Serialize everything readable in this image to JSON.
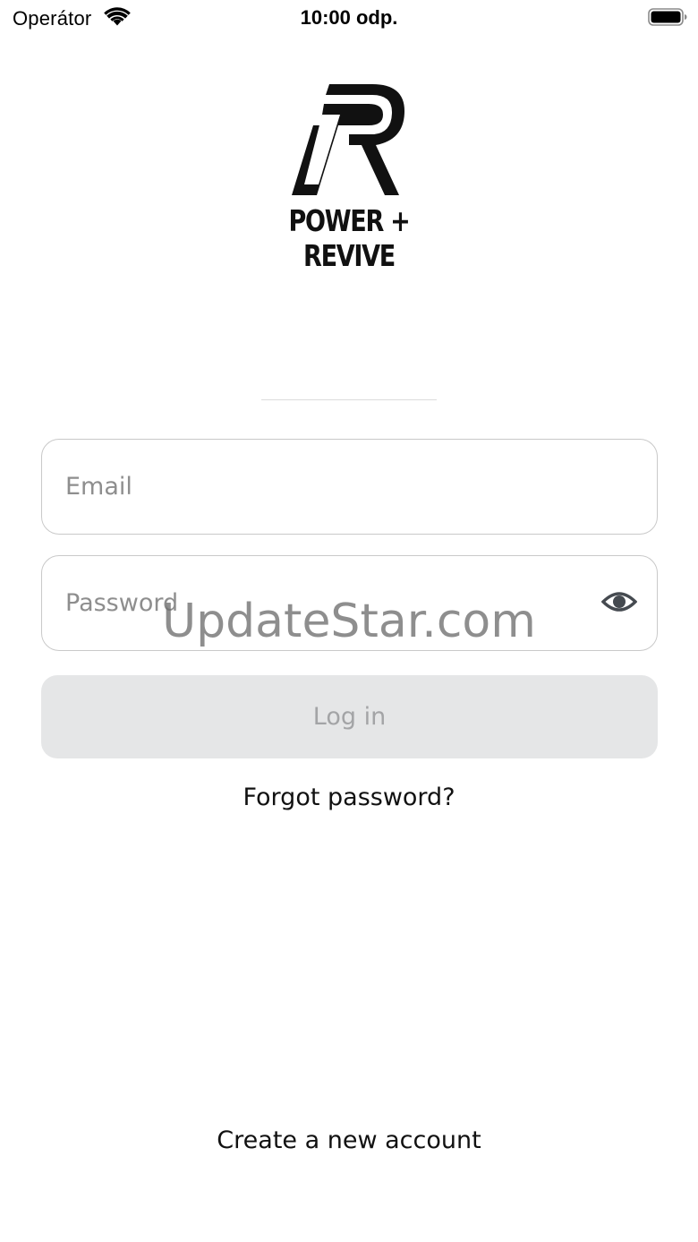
{
  "status_bar": {
    "carrier": "Operátor",
    "time": "10:00 odp.",
    "wifi_icon": "wifi-icon",
    "battery_icon": "battery-icon"
  },
  "logo": {
    "mark_icon": "power-revive-logo-mark",
    "wordmark": "POWER + REVIVE"
  },
  "form": {
    "email": {
      "placeholder": "Email",
      "value": ""
    },
    "password": {
      "placeholder": "Password",
      "value": "",
      "toggle_icon": "eye-icon"
    },
    "login_label": "Log in",
    "forgot_label": "Forgot password?"
  },
  "footer": {
    "create_account_label": "Create a new account"
  },
  "watermark": "UpdateStar.com",
  "colors": {
    "button_bg": "#e5e6e7",
    "button_text": "#a3a4a6",
    "field_border": "#c9c9c9",
    "placeholder": "#8e8e8e"
  }
}
